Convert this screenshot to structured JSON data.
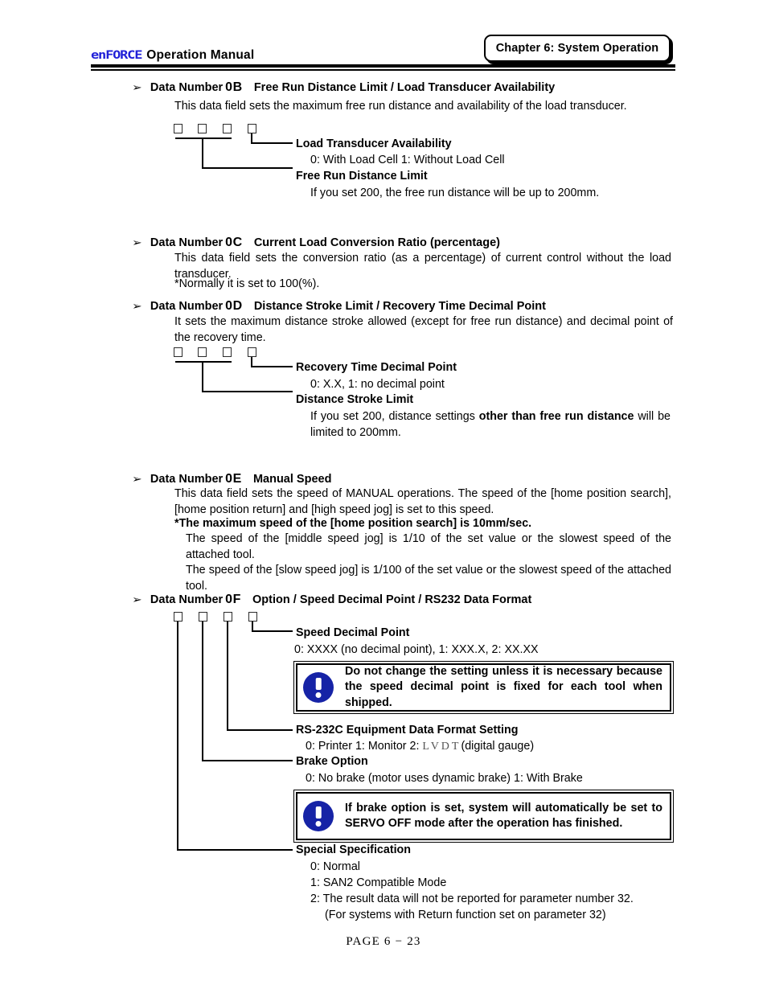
{
  "header": {
    "logo_mark": "enFORCE",
    "logo_color": "#2020d8",
    "logo_title": "Operation  Manual",
    "chapter_label": "Chapter 6: System Operation"
  },
  "footer": {
    "page_label": "PAGE  6 − 23"
  },
  "bullet_glyph": "➢",
  "entries": [
    {
      "id": "0B",
      "prefix": "Data Number",
      "number": "0B",
      "title": "Free Run Distance Limit / Load Transducer Availability",
      "intro": "This data field sets the maximum free run distance and availability of the load transducer.",
      "labels": {
        "right_label": "Load Transducer Availability",
        "right_values": "0: With Load Cell            1: Without Load Cell",
        "left_label": "Free Run Distance Limit",
        "left_values": "If you set 200, the free run distance will be up to 200mm."
      }
    },
    {
      "id": "0C",
      "prefix": "Data Number",
      "number": "0C",
      "title": "Current Load Conversion Ratio (percentage)",
      "body_line1": "This data field sets the conversion ratio (as a percentage) of current control without the load transducer.",
      "body_line2": "*Normally it is set to 100(%)."
    },
    {
      "id": "0D",
      "prefix": "Data Number",
      "number": "0D",
      "title": "Distance Stroke Limit / Recovery Time Decimal Point",
      "intro": "It sets the maximum distance stroke allowed (except for free run distance) and decimal point of the recovery time.",
      "labels": {
        "right_label": "Recovery Time Decimal Point",
        "right_values": "0: X.X,    1: no decimal point",
        "left_label": "Distance Stroke Limit",
        "left_values_pre": "If you set 200, distance settings ",
        "left_values_bold": "other than free run distance",
        "left_values_post": " will be limited to 200mm."
      }
    },
    {
      "id": "0E",
      "prefix": "Data Number",
      "number": "0E",
      "title": "Manual Speed",
      "para1": "This data field sets the speed of MANUAL operations. The speed of the [home position search], [home position return] and [high speed jog] is set to this speed.",
      "para_bold": "*The maximum speed of the [home position search] is 10mm/sec.",
      "para2": "The speed of the [middle speed jog] is 1/10 of the set value or the slowest speed of the attached tool.",
      "para3": "The speed of the [slow speed jog] is 1/100 of the set value or the slowest speed of the attached tool."
    },
    {
      "id": "0F",
      "prefix": "Data Number",
      "number": "0F",
      "title": "Option / Speed Decimal Point / RS232 Data Format",
      "labels": {
        "speed_decimal_label": "Speed Decimal Point",
        "speed_decimal_values": "0: XXXX (no decimal point),    1: XXX.X,   2: XX.XX",
        "rs232_label": "RS-232C Equipment Data Format Setting",
        "rs232_values_pre": "0: Printer   1: Monitor   2:  ",
        "rs232_values_lvdt": "LVDT",
        "rs232_values_post": "(digital gauge)",
        "brake_label": "Brake Option",
        "brake_values": "0: No brake (motor uses dynamic brake)    1: With Brake",
        "special_label": "Special Specification",
        "special_0": "0: Normal",
        "special_1": "1: SAN2 Compatible Mode",
        "special_2": "2: The result data will not be reported for parameter number 32.",
        "special_2b": "(For systems with Return function set on parameter 32)"
      },
      "warnings": [
        {
          "icon": "exclamation-circle-icon",
          "color": "#1623a6",
          "text": "Do not change the setting unless it is necessary because the speed decimal point is fixed for each tool when shipped."
        },
        {
          "icon": "exclamation-circle-icon",
          "color": "#1623a6",
          "text": "If brake option is set, system will automatically be set to SERVO OFF mode after the operation has finished."
        }
      ]
    }
  ]
}
